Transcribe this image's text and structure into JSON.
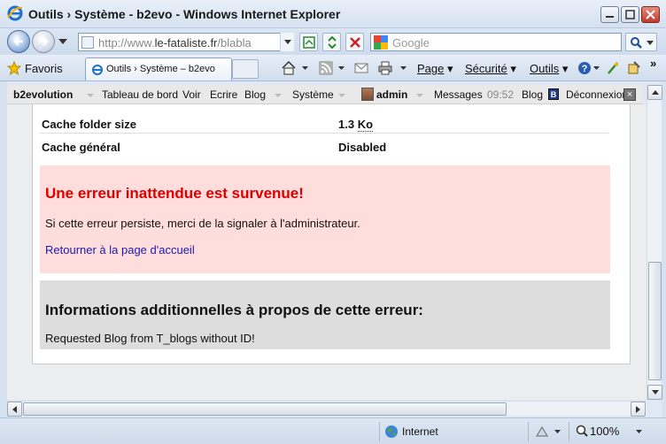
{
  "window": {
    "title": "Outils › Système - b2evo - Windows Internet Explorer"
  },
  "addressbar": {
    "url_prefix": "http://www.",
    "url_domain": "le-fataliste.fr",
    "url_suffix": "/blablа",
    "search_placeholder": "Google"
  },
  "commandbar": {
    "favorites_label": "Favoris",
    "tab_title": "Outils › Système – b2evo",
    "page_label": "Page",
    "safety_label": "Sécurité",
    "tools_label": "Outils"
  },
  "evobar": {
    "brand": "b2evolution",
    "dashboard": "Tableau de bord",
    "view": "Voir",
    "write": "Ecrire",
    "blog": "Blog",
    "system": "Système",
    "user": "admin",
    "messages": "Messages",
    "time": "09:52",
    "blog2": "Blog",
    "logout": "Déconnexion"
  },
  "content": {
    "rows": [
      {
        "key": "Cache folder size",
        "value_num": "1.3",
        "value_unit": "Ko"
      },
      {
        "key": "Cache général",
        "value_num": "Disabled",
        "value_unit": ""
      }
    ],
    "error": {
      "title": "Une erreur inattendue est survenue!",
      "message": "Si cette erreur persiste, merci de la signaler à l'administrateur.",
      "link": "Retourner à la page d'accueil"
    },
    "info": {
      "title": "Informations additionnelles à propos de cette erreur:",
      "detail": "Requested Blog from T_blogs without ID!"
    }
  },
  "statusbar": {
    "zone": "Internet",
    "zoom": "100%"
  }
}
